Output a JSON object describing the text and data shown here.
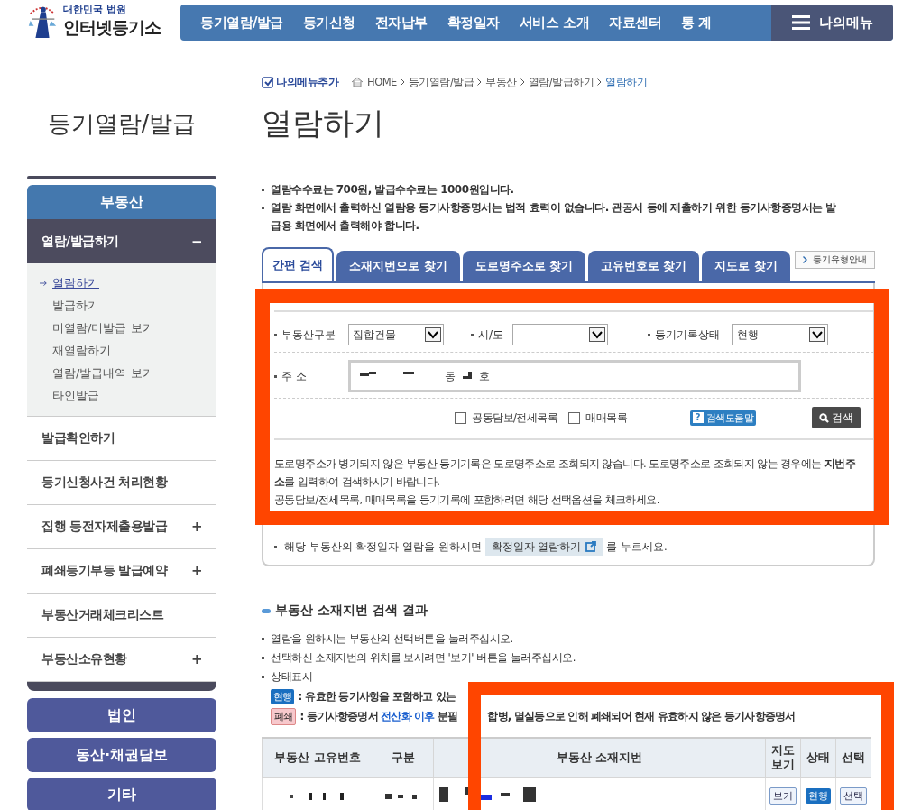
{
  "header": {
    "logo_top": "대한민국 법원",
    "logo_name": "인터넷등기소",
    "nav": [
      "등기열람/발급",
      "등기신청",
      "전자납부",
      "확정일자",
      "서비스 소개",
      "자료센터",
      "통 계"
    ],
    "my_menu": "나의메뉴"
  },
  "breadcrumb": {
    "add_menu": "나의메뉴추가",
    "items": [
      {
        "label": "HOME",
        "selected": false
      },
      {
        "label": "등기열람/발급",
        "selected": false
      },
      {
        "label": "부동산",
        "selected": false
      },
      {
        "label": "열람/발급하기",
        "selected": false
      },
      {
        "label": "열람하기",
        "selected": true
      }
    ]
  },
  "sidebar": {
    "title": "등기열람/발급",
    "section": "부동산",
    "items": [
      {
        "label": "열람/발급하기",
        "toggle": "−",
        "expanded": true,
        "children": [
          {
            "label": "열람하기",
            "selected": true
          },
          {
            "label": "발급하기",
            "selected": false
          },
          {
            "label": "미열람/미발급 보기",
            "selected": false
          },
          {
            "label": "재열람하기",
            "selected": false
          },
          {
            "label": "열람/발급내역 보기",
            "selected": false
          },
          {
            "label": "타인발급",
            "selected": false
          }
        ]
      },
      {
        "label": "발급확인하기",
        "expanded": false
      },
      {
        "label": "등기신청사건 처리현황",
        "expanded": false
      },
      {
        "label": "집행 등전자제출용발급",
        "toggle": "+",
        "expanded": false
      },
      {
        "label": "폐쇄등기부등 발급예약",
        "toggle": "+",
        "expanded": false
      },
      {
        "label": "부동산거래체크리스트",
        "expanded": false
      },
      {
        "label": "부동산소유현황",
        "toggle": "+",
        "expanded": false
      }
    ],
    "buttons": [
      "법인",
      "동산·채권담보",
      "기타"
    ]
  },
  "page_title": "열람하기",
  "notes": [
    "열람수수료는 700원, 발급수수료는 1000원입니다.",
    "열람 화면에서 출력하신 열람용 등기사항증명서는 법적 효력이 없습니다. 관공서 등에 제출하기 위한 등기사항증명서는 발급용 화면에서 출력해야 합니다."
  ],
  "tabs": [
    {
      "label": "간편 검색",
      "selected": true
    },
    {
      "label": "소재지번으로 찾기",
      "selected": false
    },
    {
      "label": "도로명주소로 찾기",
      "selected": false
    },
    {
      "label": "고유번호로 찾기",
      "selected": false
    },
    {
      "label": "지도로 찾기",
      "selected": false
    }
  ],
  "type_guide_button": "등기유형안내",
  "form": {
    "selects": [
      {
        "label": "부동산구분",
        "value": "집합건물"
      },
      {
        "label": "시/도"
      },
      {
        "label": "등기기록상태",
        "value": "현행"
      }
    ],
    "address": {
      "label": "주 소",
      "parts": [
        "동",
        "호"
      ]
    },
    "checkboxes": [
      {
        "label": "공동담보/전세목록",
        "checked": false
      },
      {
        "label": "매매목록",
        "checked": false
      }
    ],
    "help_button": "검색도움말",
    "help_icon": "?",
    "search_button": "검색"
  },
  "notices": [
    "도로명주소가 병기되지 않은 부동산 등기기록은 도로명주소로 조회되지 않습니다. 도로명주소로 조회되지 않는 경우에는 **지번주소**를 입력하여 검색하시기 바랍니다.",
    "공동담보/전세목록, 매매목록을 등기기록에 포함하려면 해당 선택옵션을 체크하세요."
  ],
  "confirm_line": {
    "before": "해당 부동산의 확정일자 열람을 원하시면",
    "button": "확정일자 열람하기",
    "after": "를 누르세요."
  },
  "results": {
    "title": "부동산 소재지번 검색 결과",
    "notes": [
      "열람을 원하시는 부동산의 선택버튼을 눌러주십시오.",
      "선택하신 소재지번의 위치를 보시려면 '보기' 버튼을 눌러주십시오.",
      "상태표시"
    ],
    "legend": [
      {
        "badge": "현행",
        "color": "#1a6fc0",
        "separator": ":",
        "text": "유효한 등기사항을 포함하고 있는"
      },
      {
        "badge": "폐쇄",
        "color": "#f7c8cc",
        "separator": ":",
        "text": "등기사항증명서 **전산화 이후** 분필",
        "text_after": "합병, 멸실등으로 인해 폐쇄되어 현재 유효하지 않은 등기사항증명서"
      }
    ],
    "columns": [
      "부동산 고유번호",
      "구분",
      "부동산 소재지번",
      "지도 보기",
      "상태",
      "선택"
    ],
    "rows": [
      {
        "map_button": "보기",
        "status": "현행",
        "color": "#1a6fc0",
        "select_button": "선택"
      }
    ]
  }
}
